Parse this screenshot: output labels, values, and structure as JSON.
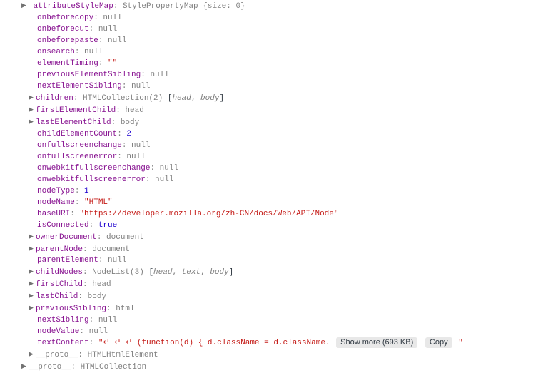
{
  "topRow": {
    "key": "attributeStyleMap",
    "type": "StylePropertyMap",
    "detail": "{size: 0}"
  },
  "entries": [
    {
      "key": "onbeforecopy",
      "value": "null",
      "vclass": "ctx"
    },
    {
      "key": "onbeforecut",
      "value": "null",
      "vclass": "ctx"
    },
    {
      "key": "onbeforepaste",
      "value": "null",
      "vclass": "ctx"
    },
    {
      "key": "onsearch",
      "value": "null",
      "vclass": "ctx"
    },
    {
      "key": "elementTiming",
      "value": "\"\"",
      "vclass": "str"
    },
    {
      "key": "previousElementSibling",
      "value": "null",
      "vclass": "ctx"
    },
    {
      "key": "nextElementSibling",
      "value": "null",
      "vclass": "ctx"
    },
    {
      "key": "children",
      "value": "HTMLCollection(2)",
      "extra": [
        "head",
        "body"
      ],
      "expandable": true
    },
    {
      "key": "firstElementChild",
      "value": "head",
      "vclass": "ctx",
      "expandable": true
    },
    {
      "key": "lastElementChild",
      "value": "body",
      "vclass": "ctx",
      "expandable": true
    },
    {
      "key": "childElementCount",
      "value": "2",
      "vclass": "num"
    },
    {
      "key": "onfullscreenchange",
      "value": "null",
      "vclass": "ctx"
    },
    {
      "key": "onfullscreenerror",
      "value": "null",
      "vclass": "ctx"
    },
    {
      "key": "onwebkitfullscreenchange",
      "value": "null",
      "vclass": "ctx"
    },
    {
      "key": "onwebkitfullscreenerror",
      "value": "null",
      "vclass": "ctx"
    },
    {
      "key": "nodeType",
      "value": "1",
      "vclass": "num"
    },
    {
      "key": "nodeName",
      "value": "\"HTML\"",
      "vclass": "str"
    },
    {
      "key": "baseURI",
      "value": "\"https://developer.mozilla.org/zh-CN/docs/Web/API/Node\"",
      "vclass": "str"
    },
    {
      "key": "isConnected",
      "value": "true",
      "vclass": "num"
    },
    {
      "key": "ownerDocument",
      "value": "document",
      "vclass": "ctx",
      "expandable": true
    },
    {
      "key": "parentNode",
      "value": "document",
      "vclass": "ctx",
      "expandable": true
    },
    {
      "key": "parentElement",
      "value": "null",
      "vclass": "ctx"
    },
    {
      "key": "childNodes",
      "value": "NodeList(3)",
      "extra": [
        "head",
        "text",
        "body"
      ],
      "expandable": true
    },
    {
      "key": "firstChild",
      "value": "head",
      "vclass": "ctx",
      "expandable": true
    },
    {
      "key": "lastChild",
      "value": "body",
      "vclass": "ctx",
      "expandable": true
    },
    {
      "key": "previousSibling",
      "value": "html",
      "vclass": "ctx",
      "expandable": true
    },
    {
      "key": "nextSibling",
      "value": "null",
      "vclass": "ctx"
    },
    {
      "key": "nodeValue",
      "value": "null",
      "vclass": "ctx"
    }
  ],
  "textContent": {
    "key": "textContent",
    "openQuote": "\"",
    "glyphs": "↵  ↵  ↵   ",
    "snippet": "(function(d) { d.className = d.className.",
    "showMore": "Show more (693 KB)",
    "copy": "Copy",
    "closeQuote": "\""
  },
  "protos": [
    {
      "key": "__proto__",
      "value": "HTMLHtmlElement",
      "indent": "indent2",
      "expandable": true
    },
    {
      "key": "__proto__",
      "value": "HTMLCollection",
      "indent": "indent1",
      "expandable": true
    }
  ]
}
